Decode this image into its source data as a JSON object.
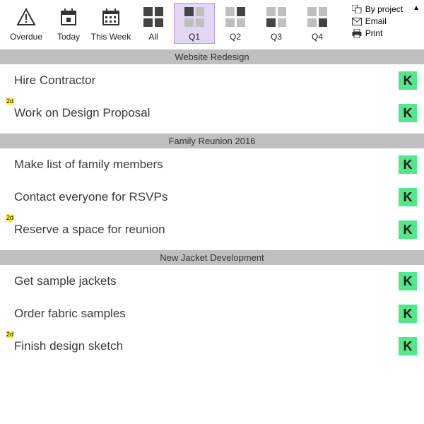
{
  "toolbar": {
    "tabs": [
      {
        "id": "overdue",
        "label": "Overdue"
      },
      {
        "id": "today",
        "label": "Today"
      },
      {
        "id": "thisweek",
        "label": "This Week"
      },
      {
        "id": "all",
        "label": "All"
      },
      {
        "id": "q1",
        "label": "Q1",
        "selected": true
      },
      {
        "id": "q2",
        "label": "Q2"
      },
      {
        "id": "q3",
        "label": "Q3"
      },
      {
        "id": "q4",
        "label": "Q4"
      }
    ],
    "menu": {
      "by_project": "By project",
      "email": "Email",
      "print": "Print"
    }
  },
  "groups": [
    {
      "title": "Website Redesign",
      "tasks": [
        {
          "title": "Hire Contractor",
          "tag": "K"
        },
        {
          "title": "Work on Design Proposal",
          "badge": "2d",
          "tag": "K"
        }
      ]
    },
    {
      "title": "Family Reunion 2016",
      "tasks": [
        {
          "title": "Make list of family members",
          "tag": "K"
        },
        {
          "title": "Contact everyone for RSVPs",
          "tag": "K"
        },
        {
          "title": "Reserve a space for reunion",
          "badge": "2d",
          "tag": "K"
        }
      ]
    },
    {
      "title": "New Jacket Development",
      "tasks": [
        {
          "title": "Get sample jackets",
          "tag": "K"
        },
        {
          "title": "Order fabric samples",
          "tag": "K"
        },
        {
          "title": "Finish design sketch",
          "badge": "2d",
          "tag": "K"
        }
      ]
    }
  ]
}
